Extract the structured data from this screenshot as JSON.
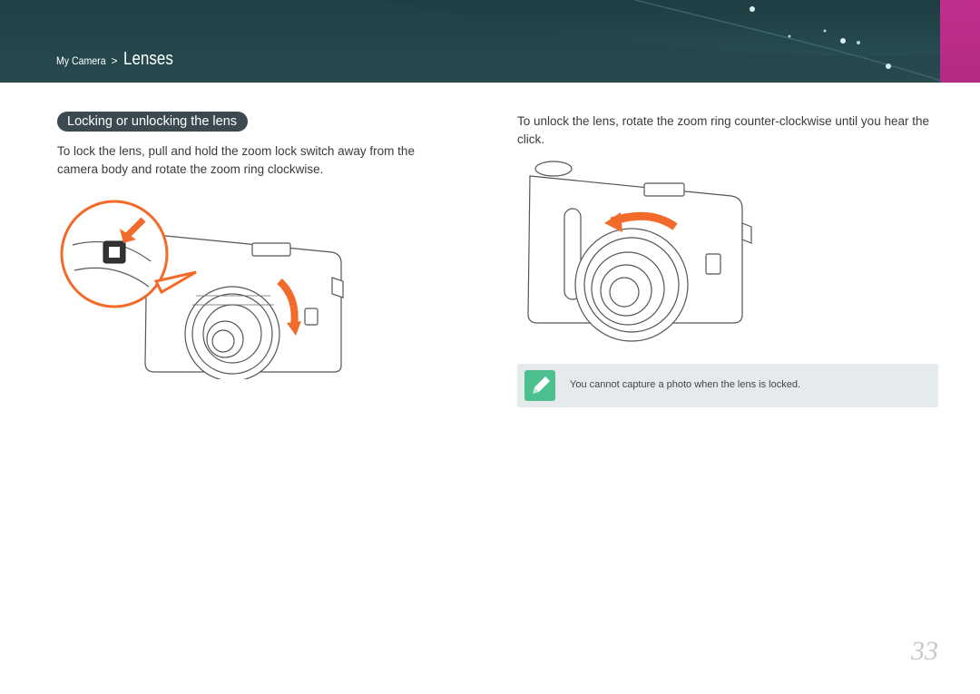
{
  "header": {
    "breadcrumb_parent": "My Camera",
    "breadcrumb_separator": ">",
    "breadcrumb_current": "Lenses",
    "accent_color": "#b82c88",
    "band_color": "#24464b"
  },
  "section": {
    "title": "Locking or unlocking the lens",
    "lock_instruction": "To lock the lens, pull and hold the zoom lock switch away from the camera body and rotate the zoom ring clockwise.",
    "unlock_instruction": "To unlock the lens, rotate the zoom ring counter-clockwise until you hear the click."
  },
  "figures": {
    "lock": {
      "icon": "camera-lock-illustration",
      "arrow_color": "#f26b2a"
    },
    "unlock": {
      "icon": "camera-unlock-illustration",
      "arrow_color": "#f26b2a"
    }
  },
  "note": {
    "icon": "pencil-note-icon",
    "icon_color": "#4cc08e",
    "text": "You cannot capture a photo when the lens is locked."
  },
  "page_number": "33"
}
